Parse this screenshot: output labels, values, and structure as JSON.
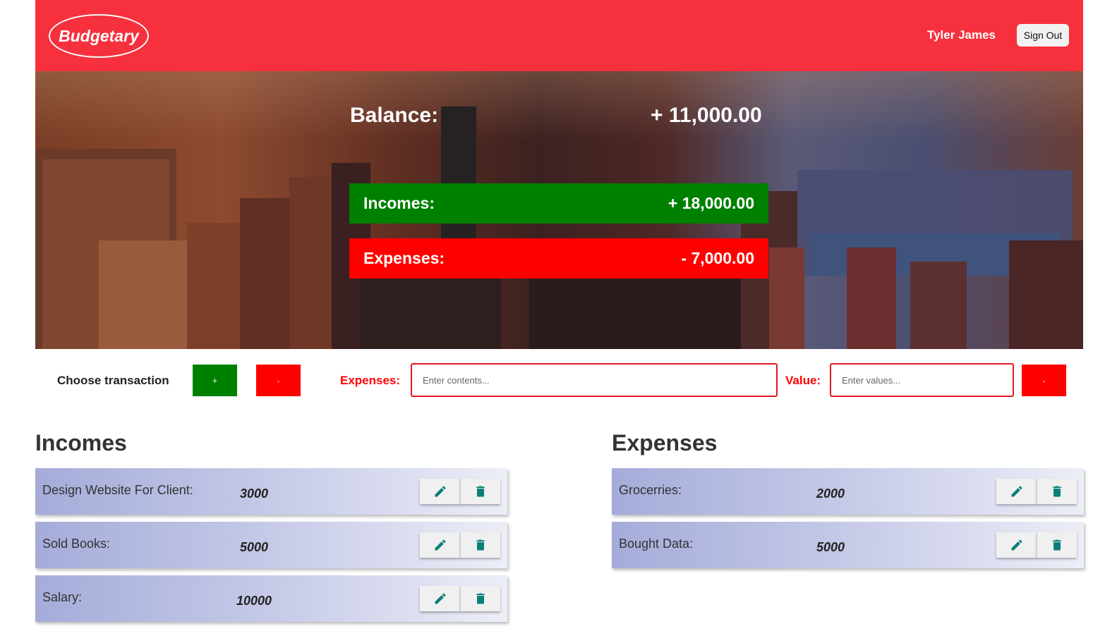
{
  "header": {
    "logo": "Budgetary",
    "user_name": "Tyler James",
    "signout_label": "Sign Out",
    "bg_color": "#f6303d"
  },
  "summary": {
    "balance_label": "Balance:",
    "balance_value": "+ 11,000.00",
    "incomes_label": "Incomes:",
    "incomes_value": "+ 18,000.00",
    "expenses_label": "Expenses:",
    "expenses_value": "- 7,000.00"
  },
  "controls": {
    "choose_label": "Choose transaction",
    "plus_label": "+",
    "minus_label": "-",
    "type_label": "Expenses:",
    "contents_placeholder": "Enter contents...",
    "value_label": "Value:",
    "values_placeholder": "Enter values...",
    "submit_label": "-"
  },
  "incomes": {
    "title": "Incomes",
    "items": [
      {
        "name": "Design Website For Client:",
        "value": "3000"
      },
      {
        "name": "Sold Books:",
        "value": "5000"
      },
      {
        "name": "Salary:",
        "value": "10000"
      }
    ]
  },
  "expenses": {
    "title": "Expenses",
    "items": [
      {
        "name": "Grocerries:",
        "value": "2000"
      },
      {
        "name": "Bought Data:",
        "value": "5000"
      }
    ]
  },
  "colors": {
    "income": "#008000",
    "expense": "#ff0000",
    "icon": "#0a7f78"
  }
}
